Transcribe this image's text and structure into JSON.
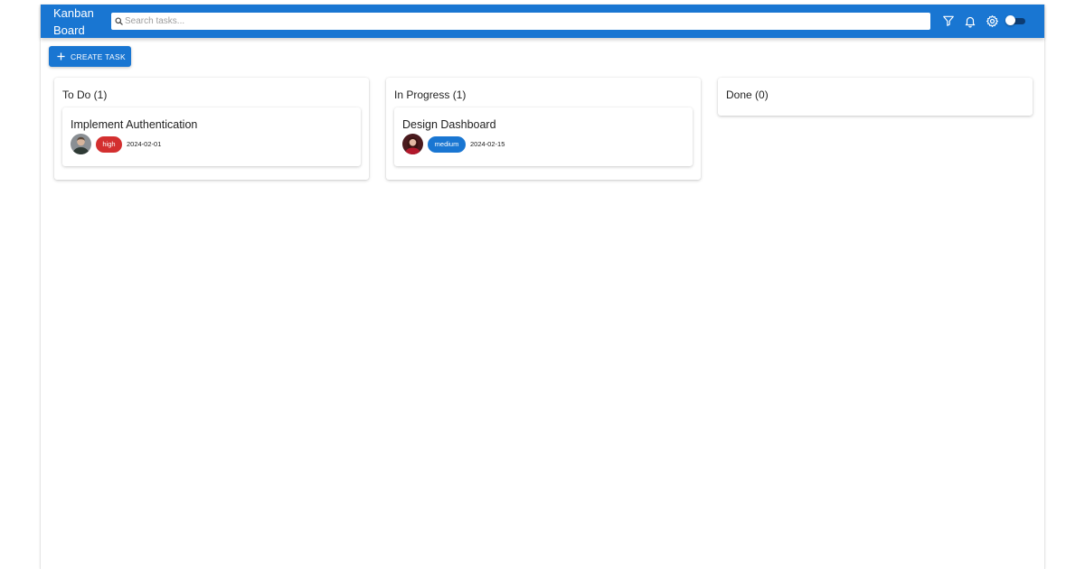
{
  "header": {
    "title": "Kanban Board",
    "search_placeholder": "Search tasks...",
    "search_value": "",
    "icons": [
      "search-icon",
      "filter-icon",
      "bell-icon",
      "gear-icon"
    ],
    "theme_toggle_on": false
  },
  "toolbar": {
    "create_label": "CREATE TASK"
  },
  "colors": {
    "primary": "#1976d2",
    "high": "#d32f2f",
    "medium": "#1976d2"
  },
  "columns": [
    {
      "title": "To Do (1)",
      "cards": [
        {
          "title": "Implement Authentication",
          "priority": "high",
          "due": "2024-02-01",
          "avatar": "man-avatar"
        }
      ]
    },
    {
      "title": "In Progress (1)",
      "cards": [
        {
          "title": "Design Dashboard",
          "priority": "medium",
          "due": "2024-02-15",
          "avatar": "woman-avatar"
        }
      ]
    },
    {
      "title": "Done (0)",
      "cards": []
    }
  ]
}
